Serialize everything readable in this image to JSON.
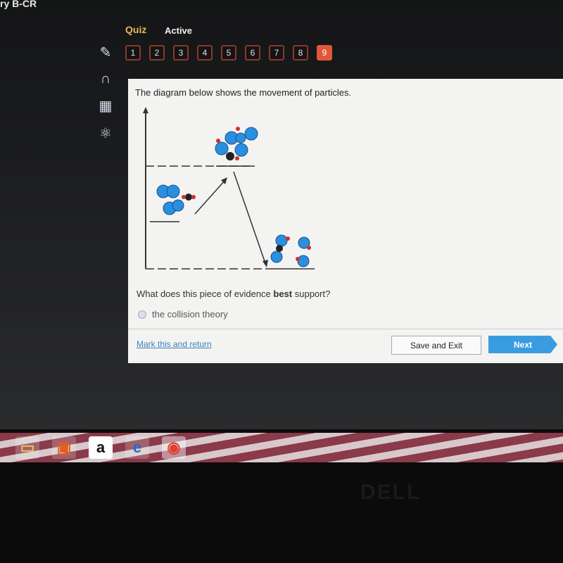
{
  "app": {
    "title": "ry B-CR"
  },
  "header": {
    "section": "Quiz",
    "status": "Active"
  },
  "questions": {
    "items": [
      "1",
      "2",
      "3",
      "4",
      "5",
      "6",
      "7",
      "8",
      "9"
    ],
    "current": "9"
  },
  "tools": [
    "pencil-icon",
    "headphones-icon",
    "calculator-icon",
    "atom-icon"
  ],
  "content": {
    "prompt": "The diagram below shows the movement of particles.",
    "question_pre": "What does this piece of evidence ",
    "question_bold": "best",
    "question_post": " support?",
    "options": [
      "the collision theory"
    ]
  },
  "footer": {
    "mark": "Mark this and return",
    "save": "Save and Exit",
    "next": "Next"
  },
  "taskbar": {
    "items": [
      "file-explorer-icon",
      "app-icon",
      "a",
      "edge-icon",
      "chrome-icon"
    ]
  },
  "colors": {
    "accent": "#e0573a",
    "quiz": "#e8b85a",
    "next": "#3a9ce0",
    "molecule": "#2b8fe0"
  }
}
